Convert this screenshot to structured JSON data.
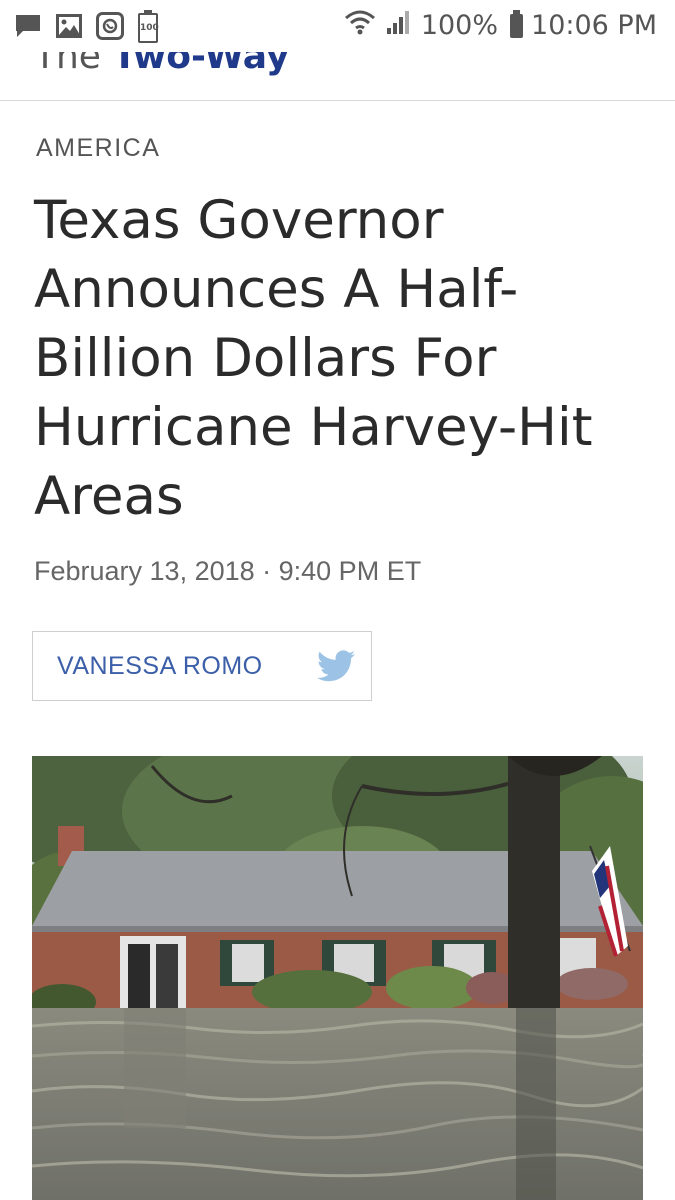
{
  "status_bar": {
    "battery_badge": "100",
    "battery_percent": "100%",
    "time": "10:06 PM"
  },
  "nav": {
    "blog_prefix": "The ",
    "blog_name": "Two-Way"
  },
  "article": {
    "section": "AMERICA",
    "headline": "Texas Governor Announces A Half-Billion Dollars For Hurricane Harvey-Hit Areas",
    "dateline": "February 13, 2018 · 9:40 PM ET",
    "author": "VANESSA ROMO"
  },
  "colors": {
    "brand_blue": "#1f3a8a",
    "author_blue": "#3b5fa8",
    "twitter_blue": "#9cc3e6"
  },
  "icons": [
    "message-icon",
    "image-icon",
    "phone-app-icon",
    "battery-icon",
    "wifi-icon",
    "signal-icon",
    "twitter-icon"
  ]
}
